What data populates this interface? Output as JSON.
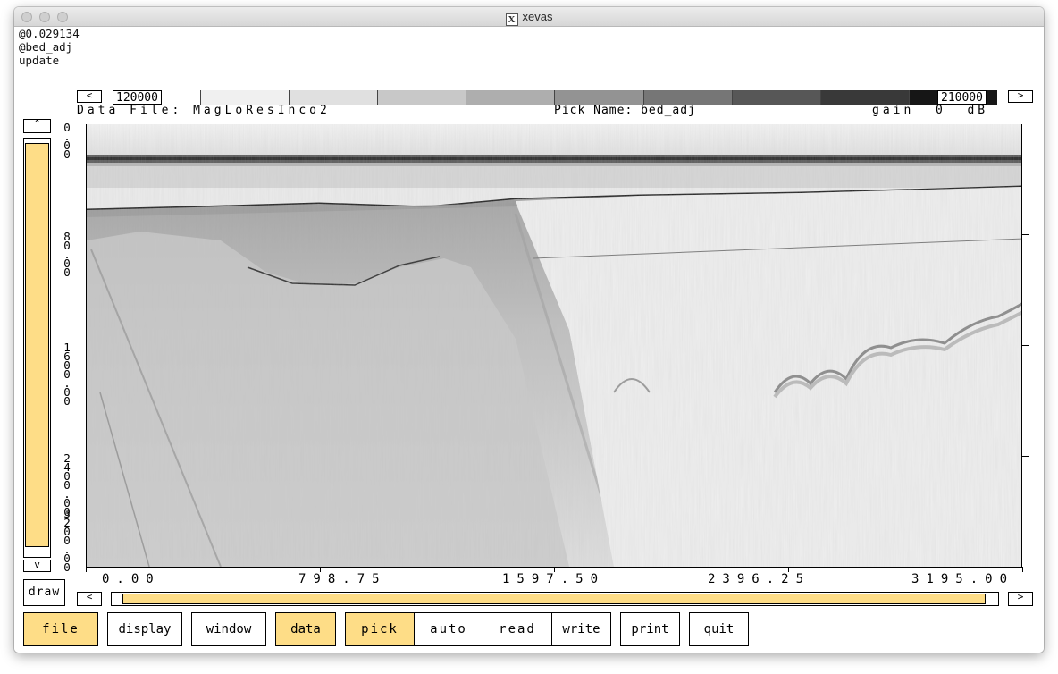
{
  "window": {
    "title": "xevas",
    "x_icon": "X"
  },
  "status_lines": [
    "@0.029134",
    "@bed_adj",
    "update"
  ],
  "colorbar": {
    "min_label": "120000",
    "max_label": "210000",
    "left_arrow": "<",
    "right_arrow": ">",
    "shades": [
      "#ffffff",
      "#f0f0f0",
      "#e0e0e0",
      "#c8c8c8",
      "#aeaeae",
      "#939393",
      "#767676",
      "#575757",
      "#393939",
      "#161616"
    ]
  },
  "info": {
    "data_file": "Data File: MagLoResInco2",
    "pick_name": "Pick Name: bed_adj",
    "gain": "gain  0  dB"
  },
  "vertical_scroll": {
    "up_arrow": "^",
    "down_arrow": "v",
    "level_percent": 100
  },
  "y_ticks": [
    "0\n.\n0\n0",
    "8\n0\n.\n0\n0",
    "1\n6\n0\n0\n.\n0\n0",
    "2\n4\n0\n0\n.\n0\n0",
    "3\n2\n0\n0\n.\n0\n0"
  ],
  "x_ticks": [
    "0.00",
    "798.75",
    "1597.50",
    "2396.25",
    "3195.00"
  ],
  "draw_button": "draw",
  "horizontal_scroll": {
    "left_arrow": "<",
    "right_arrow": ">",
    "level_percent": 100
  },
  "buttons": {
    "file": "file",
    "display": "display",
    "window": "window",
    "data": "data",
    "pick": "pick",
    "auto": "auto",
    "read": "read",
    "write": "write",
    "print": "print",
    "quit": "quit"
  },
  "colors": {
    "accent": "#fedd87",
    "border": "#000000"
  }
}
